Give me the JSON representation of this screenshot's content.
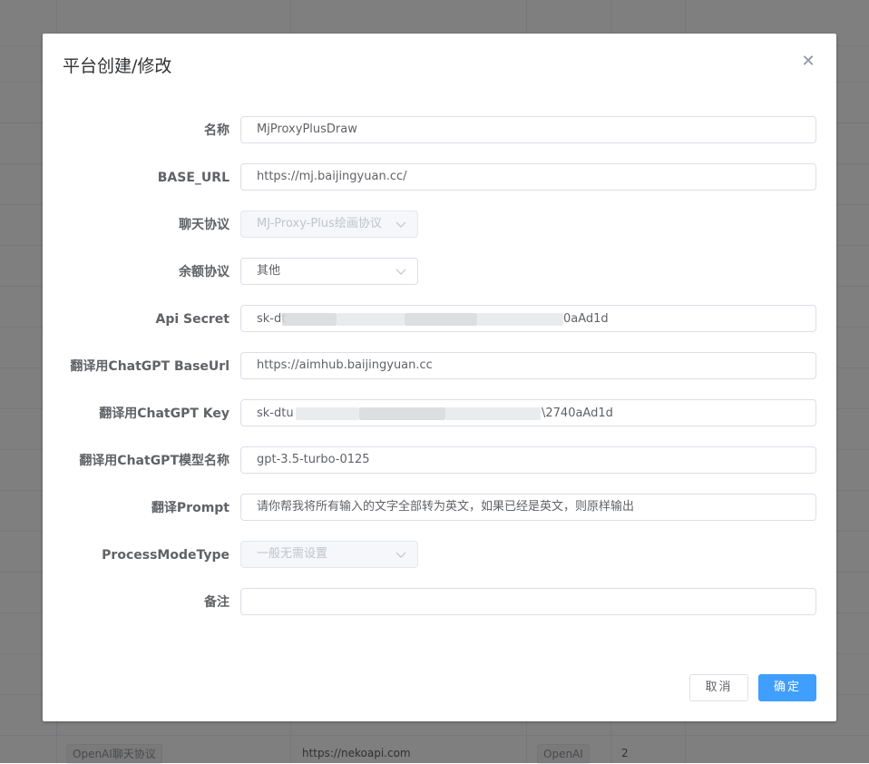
{
  "background_table": {
    "protocol_tag": "OpenAI聊天协议",
    "base_url": "https://nekoapi.com",
    "balance_tag": "OpenAI",
    "count": "2"
  },
  "dialog": {
    "title": "平台创建/修改",
    "close_icon": "close-icon",
    "fields": {
      "name": {
        "label": "名称",
        "value": "MjProxyPlusDraw"
      },
      "base_url": {
        "label": "BASE_URL",
        "value": "https://mj.baijingyuan.cc/"
      },
      "chat_protocol": {
        "label": "聊天协议",
        "value": "MJ-Proxy-Plus绘画协议"
      },
      "balance_protocol": {
        "label": "余额协议",
        "value": "其他"
      },
      "api_secret": {
        "label": "Api Secret",
        "value_start": "sk-dt",
        "value_end": "0aAd1d"
      },
      "translate_base_url": {
        "label": "翻译用ChatGPT BaseUrl",
        "value": "https://aimhub.baijingyuan.cc"
      },
      "translate_key": {
        "label": "翻译用ChatGPT Key",
        "value_start": "sk-dtu",
        "value_end": "\\2740aAd1d"
      },
      "translate_model": {
        "label": "翻译用ChatGPT模型名称",
        "value": "gpt-3.5-turbo-0125"
      },
      "translate_prompt": {
        "label": "翻译Prompt",
        "value": "请你帮我将所有输入的文字全部转为英文，如果已经是英文，则原样输出"
      },
      "process_mode_type": {
        "label": "ProcessModeType",
        "value": "一般无需设置"
      },
      "remark": {
        "label": "备注",
        "value": ""
      }
    },
    "buttons": {
      "cancel": "取消",
      "confirm": "确定"
    }
  },
  "colors": {
    "primary": "#409eff",
    "overlay": "rgba(0,0,0,0.5)"
  }
}
